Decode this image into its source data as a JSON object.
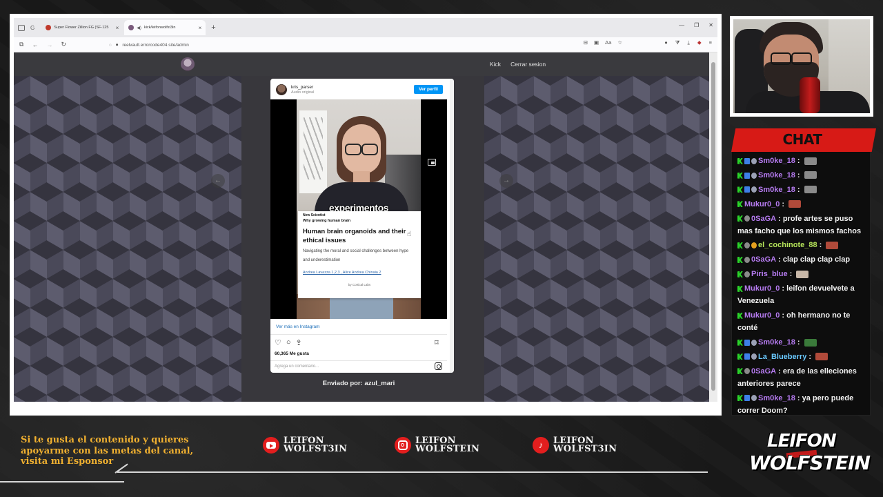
{
  "browser": {
    "tabs": [
      {
        "title": "Super Flower Zillion FG (SF-125",
        "active": false,
        "favicon_color": "#c0392b"
      },
      {
        "title": "kick/leifonwolfst3in",
        "active": true,
        "favicon_color": "#7a5b7c"
      }
    ],
    "new_tab": "+",
    "url": "reelvault.errorcode404.site/admin"
  },
  "site": {
    "nav": {
      "kick": "Kick",
      "logout": "Cerrar sesion"
    },
    "prev_arrow": "←",
    "next_arrow": "→",
    "sent_by": "Enviado por: azul_mari"
  },
  "instagram": {
    "username": "kris_parser",
    "audio": "Audio original",
    "view_profile": "Ver perfil",
    "video_caption": "experimentos",
    "card": {
      "brand": "New Scientist",
      "kicker": "Why growing human brain",
      "title": "Human brain organoids and their ethical issues",
      "description": "Navigating the moral and social challenges between hype and underestimation",
      "authors": "Andrea Lavazza 1,2,3 , Alice Andrea Chinaia 2",
      "footer": "by Cortical Labs"
    },
    "more_link": "Ver más en Instagram",
    "likes": "60,365 Me gusta",
    "comment_placeholder": "Agrega un comentario..."
  },
  "chat": {
    "header": "CHAT",
    "messages": [
      {
        "user": "Sm0ke_18",
        "color": "#b77cf2",
        "text": "",
        "badges": [
          "kick",
          "blue",
          "gift"
        ],
        "emote": "#8a8a8a"
      },
      {
        "user": "Sm0ke_18",
        "color": "#b77cf2",
        "text": "",
        "badges": [
          "kick",
          "blue",
          "gift"
        ],
        "emote": "#8a8a8a"
      },
      {
        "user": "Sm0ke_18",
        "color": "#b77cf2",
        "text": "",
        "badges": [
          "kick",
          "blue",
          "gift"
        ],
        "emote": "#8a8a8a"
      },
      {
        "user": "Mukur0_0",
        "color": "#b77cf2",
        "text": "",
        "badges": [
          "kick"
        ],
        "emote": "#b04a3a"
      },
      {
        "user": "0SaGA",
        "color": "#b77cf2",
        "text": "profe artes se puso mas facho que los mismos fachos",
        "badges": [
          "kick",
          "plug"
        ],
        "emote": ""
      },
      {
        "user": "el_cochinote_88",
        "color": "#b6e55a",
        "text": "",
        "badges": [
          "kick",
          "plug",
          "gold"
        ],
        "emote": "#b04a3a"
      },
      {
        "user": "0SaGA",
        "color": "#b77cf2",
        "text": "clap clap clap clap",
        "badges": [
          "kick",
          "plug"
        ],
        "emote": ""
      },
      {
        "user": "Piris_blue",
        "color": "#b77cf2",
        "text": "",
        "badges": [
          "kick",
          "plug"
        ],
        "emote": "#c8b8a8"
      },
      {
        "user": "Mukur0_0",
        "color": "#b77cf2",
        "text": "leifon devuelvete a Venezuela",
        "badges": [
          "kick"
        ],
        "emote": ""
      },
      {
        "user": "Mukur0_0",
        "color": "#b77cf2",
        "text": "oh hermano no te conté",
        "badges": [
          "kick"
        ],
        "emote": ""
      },
      {
        "user": "Sm0ke_18",
        "color": "#b77cf2",
        "text": "",
        "badges": [
          "kick",
          "blue",
          "gift"
        ],
        "emote": "#3a7a3a"
      },
      {
        "user": "La_Blueberry",
        "color": "#6ac9ff",
        "text": "",
        "badges": [
          "kick",
          "blue",
          "gift"
        ],
        "emote": "#b04a3a"
      },
      {
        "user": "0SaGA",
        "color": "#b77cf2",
        "text": "era de las elleciones anteriores parece",
        "badges": [
          "kick",
          "plug"
        ],
        "emote": ""
      },
      {
        "user": "Sm0ke_18",
        "color": "#b77cf2",
        "text": "ya pero puede correr Doom?",
        "badges": [
          "kick",
          "blue",
          "gift"
        ],
        "emote": ""
      }
    ]
  },
  "overlay": {
    "sponsor_text": "Si te gusta el contenido y quieres apoyarme con las metas del canal, visita mi Esponsor",
    "socials": [
      {
        "network": "youtube",
        "icon": "youtube-icon",
        "line1": "LEIFON",
        "line2": "WOLFST3IN"
      },
      {
        "network": "instagram",
        "icon": "instagram-icon",
        "line1": "LEIFON",
        "line2": "WOLFSTEIN"
      },
      {
        "network": "tiktok",
        "icon": "tiktok-icon",
        "line1": "LEIFON",
        "line2": "WOLFST3IN"
      }
    ],
    "brand_line1": "LEIFON",
    "brand_line2": "WOLFSTEIN"
  }
}
